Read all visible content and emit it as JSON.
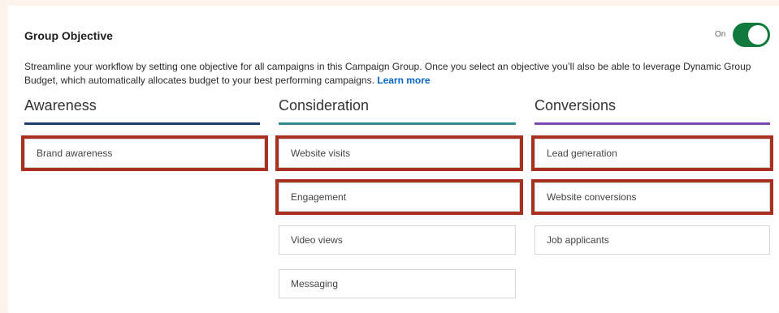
{
  "header": {
    "title": "Group Objective",
    "toggle_label": "On"
  },
  "description": {
    "text": "Streamline your workflow by setting one objective for all campaigns in this Campaign Group. Once you select an objective you’ll also be able to leverage Dynamic Group Budget, which automatically allocates budget to your best performing campaigns.",
    "link": "Learn more"
  },
  "columns": [
    {
      "heading": "Awareness",
      "accent": "#1d3e6e",
      "options": [
        "Brand awareness"
      ]
    },
    {
      "heading": "Consideration",
      "accent": "#2f8a8e",
      "options": [
        "Website visits",
        "Engagement",
        "Video views",
        "Messaging"
      ]
    },
    {
      "heading": "Conversions",
      "accent": "#7c48b8",
      "options": [
        "Lead generation",
        "Website conversions",
        "Job applicants"
      ]
    }
  ],
  "colors": {
    "toggle_on": "#0f7a3b",
    "highlight": "#a8301f",
    "link": "#0a66c2"
  }
}
